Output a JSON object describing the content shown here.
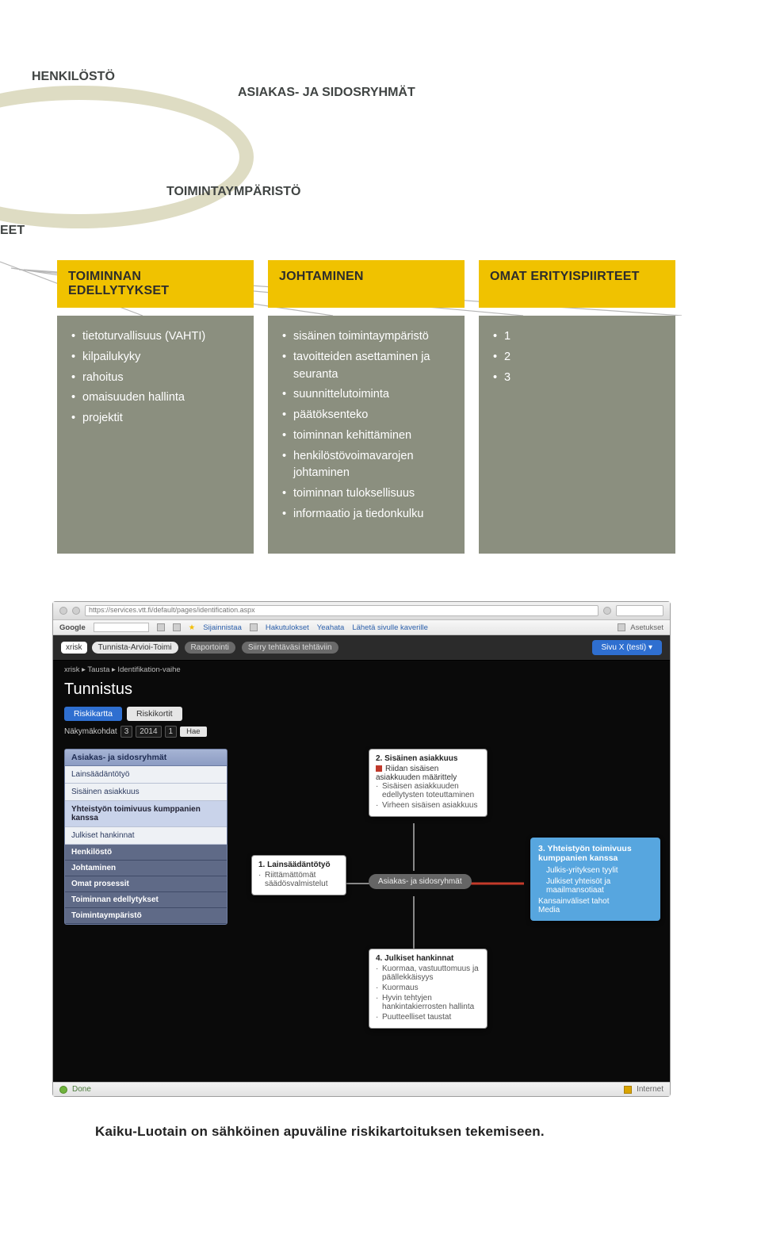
{
  "labels": {
    "henkilosto": "HENKILÖSTÖ",
    "asiakas": "ASIAKAS- JA SIDOSRYHMÄT",
    "toimintaymparisto": "TOIMINTAYMPÄRISTÖ",
    "eet": "EET"
  },
  "columns": {
    "c1": {
      "header": "TOIMINNAN EDELLYTYKSET",
      "items": [
        "tietoturvallisuus (VAHTI)",
        "kilpailukyky",
        "rahoitus",
        "omaisuuden hallinta",
        "projektit"
      ]
    },
    "c2": {
      "header": "JOHTAMINEN",
      "items": [
        "sisäinen toimintaympäristö",
        "tavoitteiden asettaminen ja seuranta",
        "suunnittelutoiminta",
        "päätöksenteko",
        "toiminnan kehittäminen",
        "henkilöstövoimavarojen johtaminen",
        "toiminnan tuloksellisuus",
        "informaatio ja tiedonkulku"
      ]
    },
    "c3": {
      "header": "OMAT ERITYISPIIRTEET",
      "items": [
        "1",
        "2",
        "3"
      ]
    }
  },
  "browser": {
    "address": "https://services.vtt.fi/default/pages/identification.aspx",
    "google_label": "Google",
    "toolbox_items": [
      "Sijainnistaa",
      "Hakutulokset",
      "Yeahata",
      "Lähetä sivulle kaverille"
    ],
    "right_label": "Asetukset"
  },
  "app": {
    "white_tab": "xrisk",
    "grey_tab1": "Tunnista-Arvioi-Toimi",
    "grey_tab2": "Raportointi",
    "grey_tab3": "Siirry tehtäväsi tehtäviin",
    "blue_button": "Sivu X (testi) ▾",
    "breadcrumb": "xrisk ▸ Tausta ▸ Identifikation-vaihe",
    "title": "Tunnistus",
    "subtab_active": "Riskikartta",
    "subtab_inactive": "Riskikortit",
    "date_label": "Näkymäkohdat",
    "date_month": "3",
    "date_year": "2014",
    "date_day": "1",
    "date_btn": "Hae"
  },
  "leftpanel": {
    "group1_header": "Asiakas- ja sidosryhmät",
    "group1_items": [
      {
        "label": "Lainsäädäntötyö",
        "sel": false
      },
      {
        "label": "Sisäinen asiakkuus",
        "sel": false
      },
      {
        "label": "Yhteistyön toimivuus kumppanien kanssa",
        "sel": true
      },
      {
        "label": "Julkiset hankinnat",
        "sel": false
      }
    ],
    "sections": [
      "Henkilöstö",
      "Johtaminen",
      "Omat prosessit",
      "Toiminnan edellytykset",
      "Toimintaympäristö"
    ]
  },
  "nodes": {
    "top": {
      "title": "2. Sisäinen asiakkuus",
      "flagged_item": "Riidan sisäisen asiakkuuden määrittely",
      "items": [
        "Sisäisen asiakkuuden edellytysten toteuttaminen",
        "Virheen sisäisen asiakkuus"
      ]
    },
    "left": {
      "title": "1. Lainsäädäntötyö",
      "items": [
        "Riittämättömät säädösvalmistelut"
      ]
    },
    "bottom": {
      "title": "4. Julkiset hankinnat",
      "items": [
        "Kuormaa, vastuuttomuus ja päällekkäisyys",
        "Kuormaus",
        "Hyvin tehtyjen hankintakierrosten hallinta",
        "Puutteelliset taustat"
      ]
    },
    "center_pill": "Asiakas- ja sidosryhmät",
    "bluecard": {
      "title": "3. Yhteistyön toimivuus kumppanien kanssa",
      "lines": [
        {
          "text": "Julkis-yrityksen tyylit",
          "indent": true
        },
        {
          "text": "Julkiset yhteisöt ja maailmansotiaat",
          "indent": true
        },
        {
          "text": "Kansainväliset tahot",
          "indent": false
        },
        {
          "text": "Media",
          "indent": false
        }
      ]
    }
  },
  "statusbar": {
    "left": "Done",
    "right": "Internet"
  },
  "caption": "Kaiku-Luotain on sähköinen apuväline riskikartoituksen tekemiseen."
}
